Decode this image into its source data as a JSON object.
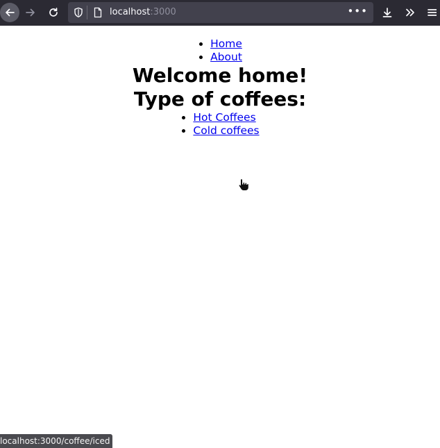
{
  "browser": {
    "url_host": "localhost",
    "url_port": ":3000",
    "status_url": "localhost:3000/coffee/iced"
  },
  "nav": {
    "items": [
      {
        "label": "Home"
      },
      {
        "label": "About"
      }
    ]
  },
  "main": {
    "welcome_heading": "Welcome home!",
    "types_heading": "Type of coffees:",
    "coffees": [
      {
        "label": "Hot Coffees"
      },
      {
        "label": "Cold coffees"
      }
    ]
  },
  "colors": {
    "toolbar_bg": "#2b2a33",
    "urlbar_bg": "#42414d",
    "link": "#0000ee"
  }
}
